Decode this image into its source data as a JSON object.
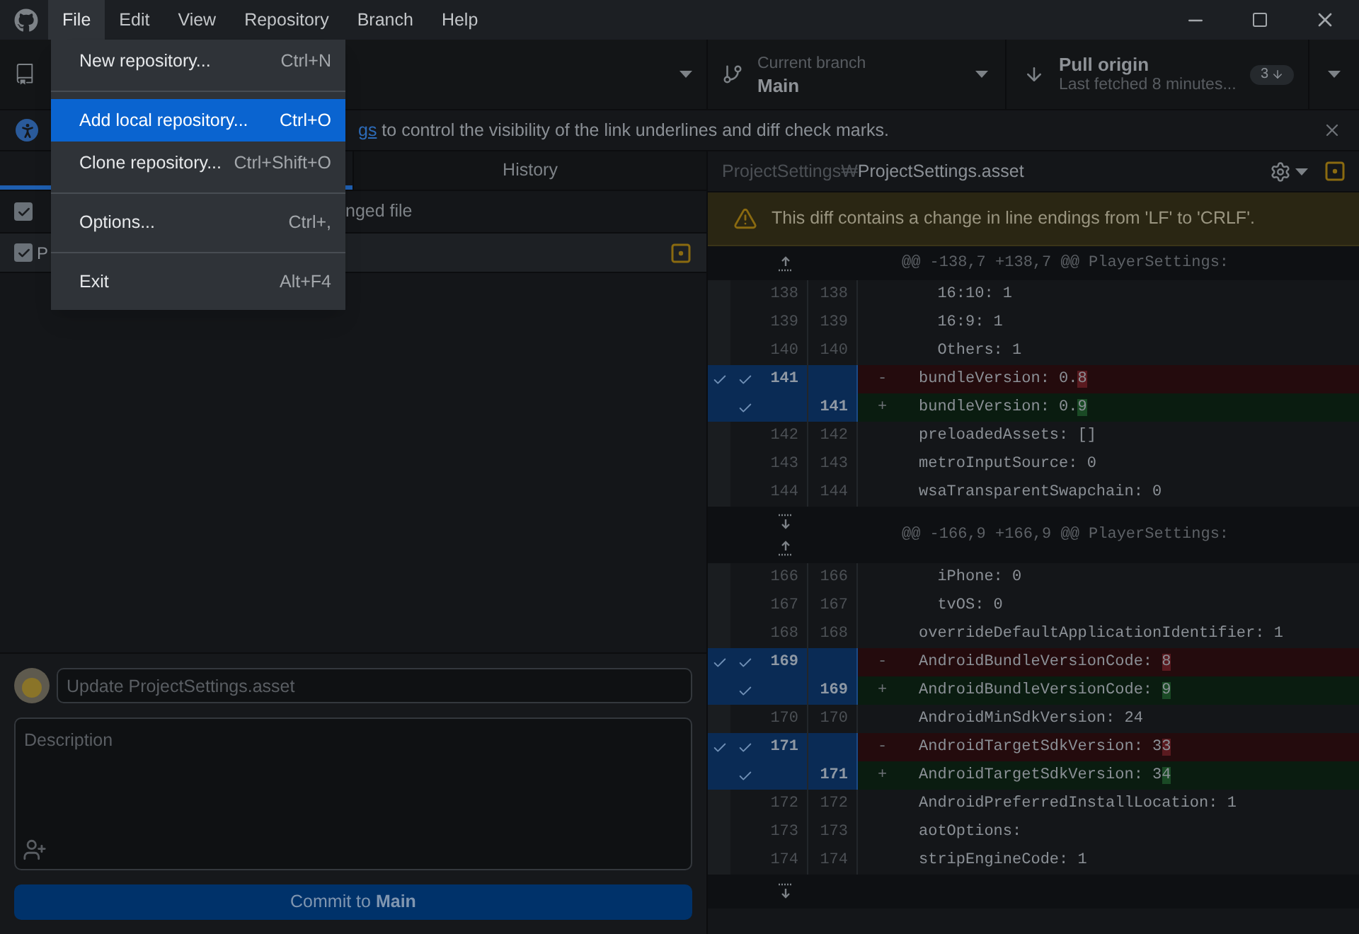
{
  "menubar": {
    "items": [
      {
        "label": "File",
        "selected": true
      },
      {
        "label": "Edit",
        "selected": false
      },
      {
        "label": "View",
        "selected": false
      },
      {
        "label": "Repository",
        "selected": false
      },
      {
        "label": "Branch",
        "selected": false
      },
      {
        "label": "Help",
        "selected": false
      }
    ]
  },
  "file_menu": {
    "items": [
      {
        "kind": "item",
        "label": "New repository...",
        "shortcut": "Ctrl+N",
        "selected": false
      },
      {
        "kind": "separator"
      },
      {
        "kind": "item",
        "label": "Add local repository...",
        "shortcut": "Ctrl+O",
        "selected": true
      },
      {
        "kind": "item",
        "label": "Clone repository...",
        "shortcut": "Ctrl+Shift+O",
        "selected": false
      },
      {
        "kind": "separator"
      },
      {
        "kind": "item",
        "label": "Options...",
        "shortcut": "Ctrl+,",
        "selected": false
      },
      {
        "kind": "separator"
      },
      {
        "kind": "item",
        "label": "Exit",
        "shortcut": "Alt+F4",
        "selected": false
      }
    ]
  },
  "toolbar": {
    "branch": {
      "label": "Current branch",
      "value": "Main"
    },
    "pull": {
      "title": "Pull origin",
      "subtitle": "Last fetched 8 minutes...",
      "badge": "3"
    }
  },
  "banner": {
    "link": "gs",
    "text": " to control the visibility of the link underlines and diff check marks."
  },
  "tabs": [
    {
      "selected": true
    },
    {
      "label": "History",
      "selected": false
    }
  ],
  "changes": {
    "header": {
      "checked": true,
      "text": "nged file"
    },
    "files": [
      {
        "name": "P",
        "checked": true
      }
    ]
  },
  "commit": {
    "summary_placeholder": "Update ProjectSettings.asset",
    "description_placeholder": "Description",
    "button": "Commit to **Main**"
  },
  "diff": {
    "path_dir": "ProjectSettings₩",
    "path_file": "ProjectSettings.asset",
    "warning": "This diff contains a change in line endings from 'LF' to 'CRLF'.",
    "rows": [
      {
        "kind": "hunk",
        "expand_up": true,
        "text": "@@ -138,7 +138,7 @@ PlayerSettings:"
      },
      {
        "kind": "context",
        "old": "138",
        "new": "138",
        "text": "  16:10: 1"
      },
      {
        "kind": "context",
        "old": "139",
        "new": "139",
        "text": "  16:9: 1"
      },
      {
        "kind": "context",
        "old": "140",
        "new": "140",
        "text": "  Others: 1"
      },
      {
        "kind": "del",
        "old": "141",
        "sign": "-",
        "text": "bundleVersion: 0.",
        "highlight": "8",
        "checked": true,
        "hunk_checked": true
      },
      {
        "kind": "add",
        "new": "141",
        "sign": "+",
        "text": "bundleVersion: 0.",
        "highlight": "9",
        "checked": true
      },
      {
        "kind": "context",
        "old": "142",
        "new": "142",
        "text": "preloadedAssets: []"
      },
      {
        "kind": "context",
        "old": "143",
        "new": "143",
        "text": "metroInputSource: 0"
      },
      {
        "kind": "context",
        "old": "144",
        "new": "144",
        "text": "wsaTransparentSwapchain: 0"
      },
      {
        "kind": "hunk",
        "expand_up": true,
        "expand_down": true,
        "text": "@@ -166,9 +166,9 @@ PlayerSettings:"
      },
      {
        "kind": "context",
        "old": "166",
        "new": "166",
        "text": "  iPhone: 0"
      },
      {
        "kind": "context",
        "old": "167",
        "new": "167",
        "text": "  tvOS: 0"
      },
      {
        "kind": "context",
        "old": "168",
        "new": "168",
        "text": "overrideDefaultApplicationIdentifier: 1"
      },
      {
        "kind": "del",
        "old": "169",
        "sign": "-",
        "text": "AndroidBundleVersionCode: ",
        "highlight": "8",
        "checked": true,
        "hunk_checked": true
      },
      {
        "kind": "add",
        "new": "169",
        "sign": "+",
        "text": "AndroidBundleVersionCode: ",
        "highlight": "9",
        "checked": true
      },
      {
        "kind": "context",
        "old": "170",
        "new": "170",
        "text": "AndroidMinSdkVersion: 24"
      },
      {
        "kind": "del",
        "old": "171",
        "sign": "-",
        "text": "AndroidTargetSdkVersion: 3",
        "highlight": "3",
        "checked": true,
        "hunk_checked": true
      },
      {
        "kind": "add",
        "new": "171",
        "sign": "+",
        "text": "AndroidTargetSdkVersion: 3",
        "highlight": "4",
        "checked": true
      },
      {
        "kind": "context",
        "old": "172",
        "new": "172",
        "text": "AndroidPreferredInstallLocation: 1"
      },
      {
        "kind": "context",
        "old": "173",
        "new": "173",
        "text": "aotOptions:"
      },
      {
        "kind": "context",
        "old": "174",
        "new": "174",
        "text": "stripEngineCode: 1"
      },
      {
        "kind": "hunk",
        "expand_down": true
      }
    ]
  }
}
